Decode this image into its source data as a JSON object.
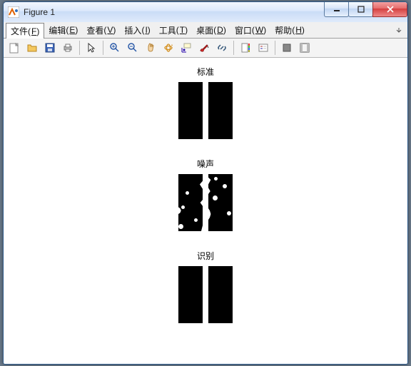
{
  "window": {
    "title": "Figure 1"
  },
  "menus": {
    "file": {
      "label": "文件",
      "key": "F"
    },
    "edit": {
      "label": "编辑",
      "key": "E"
    },
    "view": {
      "label": "查看",
      "key": "V"
    },
    "insert": {
      "label": "插入",
      "key": "I"
    },
    "tools": {
      "label": "工具",
      "key": "T"
    },
    "desktop": {
      "label": "桌面",
      "key": "D"
    },
    "window": {
      "label": "窗口",
      "key": "W"
    },
    "help": {
      "label": "帮助",
      "key": "H"
    }
  },
  "toolbar": {
    "new": "New Figure",
    "open": "Open File",
    "save": "Save Figure",
    "print": "Print Figure",
    "pointer": "Edit Plot",
    "zoom_in": "Zoom In",
    "zoom_out": "Zoom Out",
    "pan": "Pan",
    "rotate": "Rotate 3D",
    "datatip": "Data Cursor",
    "brush": "Brush",
    "link": "Link Plot",
    "colorbar": "Insert Colorbar",
    "legend": "Insert Legend",
    "hide": "Hide Plot Tools",
    "show": "Show Plot Tools"
  },
  "plots": {
    "p1": {
      "title": "标准"
    },
    "p2": {
      "title": "噪声"
    },
    "p3": {
      "title": "识别"
    }
  },
  "chart_data": [
    {
      "type": "heatmap",
      "title": "标准",
      "description": "binary image: two black vertical bars with a white gap",
      "size": [
        76,
        80
      ]
    },
    {
      "type": "heatmap",
      "title": "噪声",
      "description": "standard image with additive noise: irregular white spots and wavy gap edges",
      "size": [
        76,
        80
      ]
    },
    {
      "type": "heatmap",
      "title": "识别",
      "description": "recognized/denoised output: two black vertical bars with a white gap",
      "size": [
        76,
        80
      ]
    }
  ]
}
